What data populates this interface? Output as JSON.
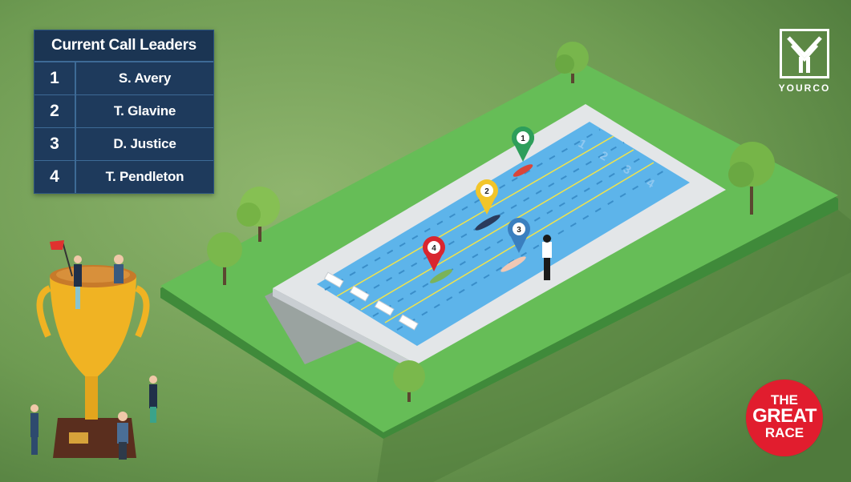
{
  "leaderboard": {
    "title": "Current Call Leaders",
    "rows": [
      {
        "rank": "1",
        "name": "S. Avery"
      },
      {
        "rank": "2",
        "name": "T. Glavine"
      },
      {
        "rank": "3",
        "name": "D. Justice"
      },
      {
        "rank": "4",
        "name": "T. Pendleton"
      }
    ]
  },
  "logo": {
    "text": "YOURCO"
  },
  "badge": {
    "line1": "THE",
    "line2": "GREAT",
    "line3": "RACE"
  },
  "pool": {
    "lane_numbers": [
      "1",
      "2",
      "3",
      "4"
    ],
    "markers": [
      {
        "label": "1",
        "color": "#2e9e5b"
      },
      {
        "label": "2",
        "color": "#f2c52a"
      },
      {
        "label": "3",
        "color": "#3a7fbf"
      },
      {
        "label": "4",
        "color": "#d9262f"
      }
    ]
  },
  "colors": {
    "background": "#6b9a4f",
    "grass": "#69c05a",
    "pool_water": "#5fb5ec",
    "pool_deck": "#e6e8ea",
    "panel": "#1e3a5c",
    "badge": "#e11d2e"
  }
}
